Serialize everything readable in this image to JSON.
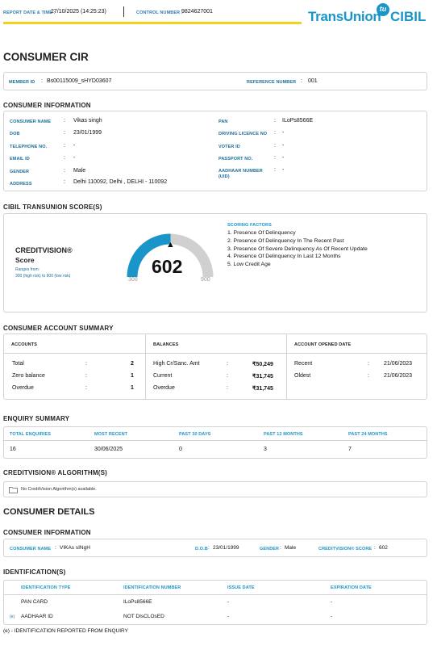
{
  "header": {
    "report_date_label": "REPORT DATE & TIME :",
    "report_date_value": "27/10/2025 (14:25:23)",
    "control_label": "CONTROL NUMBER :",
    "control_value": "9824627001",
    "brand_main": "TransUnion",
    "brand_sub": "CIBIL",
    "brand_badge": "tu",
    "accent_yellow": "#f2d21a",
    "accent_teal": "#1a95c9"
  },
  "title": "CONSUMER CIR",
  "member": {
    "member_id_label": "MEMBER ID",
    "member_id_value": "Bs00115009_sHYD03607",
    "reference_label": "REFERENCE NUMBER",
    "reference_value": "001"
  },
  "consumer_information": {
    "title": "CONSUMER INFORMATION",
    "left": [
      {
        "label": "CONSUMER NAME",
        "value": "Vikas singh"
      },
      {
        "label": "DOB",
        "value": "23/01/1999"
      },
      {
        "label": "TELEPHONE NO.",
        "value": "-"
      },
      {
        "label": "EMAIL ID",
        "value": "-"
      },
      {
        "label": "GENDER",
        "value": "Male"
      },
      {
        "label": "ADDRESS",
        "value": "Delhi 110092, Delhi , DELHI - 110092"
      }
    ],
    "right": [
      {
        "label": "PAN",
        "value": "ILoPs8566E"
      },
      {
        "label": "DRIVING LICENCE NO",
        "value": "-"
      },
      {
        "label": "VOTER ID",
        "value": "-"
      },
      {
        "label": "PASSPORT NO.",
        "value": "-"
      },
      {
        "label": "AADHAAR NUMBER (UID)",
        "value": "-"
      }
    ]
  },
  "score_section": {
    "title": "CIBIL TRANSUNION SCORE(S)",
    "product_name": "CREDITVISION®",
    "product_sub": "Score",
    "ranges_label": "Ranges from:",
    "ranges_value": "300 (high risk) to 900 (low risk)",
    "score": "602",
    "score_numeric": 602,
    "gauge_min": "300",
    "gauge_max": "900",
    "factors_title": "SCORING FACTORS",
    "factors": [
      "1. Presence Of Delinquency",
      "2. Presence Of Delinquency In The Recent Past",
      "3. Presence Of Severe Delinquency As Of Recent Update",
      "4. Presence Of Delinquency In Last 12 Months",
      "5. Low Credit Age"
    ]
  },
  "account_summary": {
    "title": "CONSUMER ACCOUNT SUMMARY",
    "accounts_header": "ACCOUNTS",
    "balances_header": "BALANCES",
    "opened_header": "ACCOUNT OPENED DATE",
    "accounts": [
      {
        "label": "Total",
        "value": "2"
      },
      {
        "label": "Zero balance",
        "value": "1"
      },
      {
        "label": "Overdue",
        "value": "1"
      }
    ],
    "balances": [
      {
        "label": "High Cr/Sanc. Amt",
        "value": "₹50,249"
      },
      {
        "label": "Current",
        "value": "₹31,745"
      },
      {
        "label": "Overdue",
        "value": "₹31,745"
      }
    ],
    "opened": [
      {
        "label": "Recent",
        "value": "21/06/2023"
      },
      {
        "label": "Oldest",
        "value": "21/06/2023"
      }
    ]
  },
  "enquiry_summary": {
    "title": "ENQUIRY SUMMARY",
    "headers": [
      "TOTAL ENQUIRIES",
      "MOST RECENT",
      "PAST 30 DAYS",
      "PAST 12 MONTHS",
      "PAST 24 MONTHS"
    ],
    "values": [
      "16",
      "30/06/2025",
      "0",
      "3",
      "7"
    ]
  },
  "algorithm": {
    "title": "CREDITVISION® ALGORITHM(S)",
    "message": "No CreditVision Algorithm(s) available."
  },
  "consumer_details": {
    "title": "CONSUMER DETAILS",
    "info_title": "CONSUMER INFORMATION",
    "name_label": "CONSUMER NAME",
    "name_value": "VIKAs sINgH",
    "dob_label": "D.O.B",
    "dob_value": "23/01/1999",
    "gender_label": "GENDER",
    "gender_value": "Male",
    "score_label": "CREDITVISION® SCORE",
    "score_value": "602"
  },
  "identification": {
    "title": "IDENTIFICATION(S)",
    "headers": [
      "IDENTIFICATION TYPE",
      "IDENTIFICATION NUMBER",
      "ISSUE DATE",
      "EXPIRATION DATE"
    ],
    "rows": [
      {
        "marker": "",
        "type": "PAN CARD",
        "number": "ILoPs8566E",
        "issue": "-",
        "expiry": "-"
      },
      {
        "marker": "(e)",
        "type": "AADHAAR ID",
        "number": "NOT DIsCLOsED",
        "issue": "-",
        "expiry": "-"
      }
    ],
    "footnote": "(e) - IDENTIFICATION REPORTED FROM ENQUIRY"
  }
}
